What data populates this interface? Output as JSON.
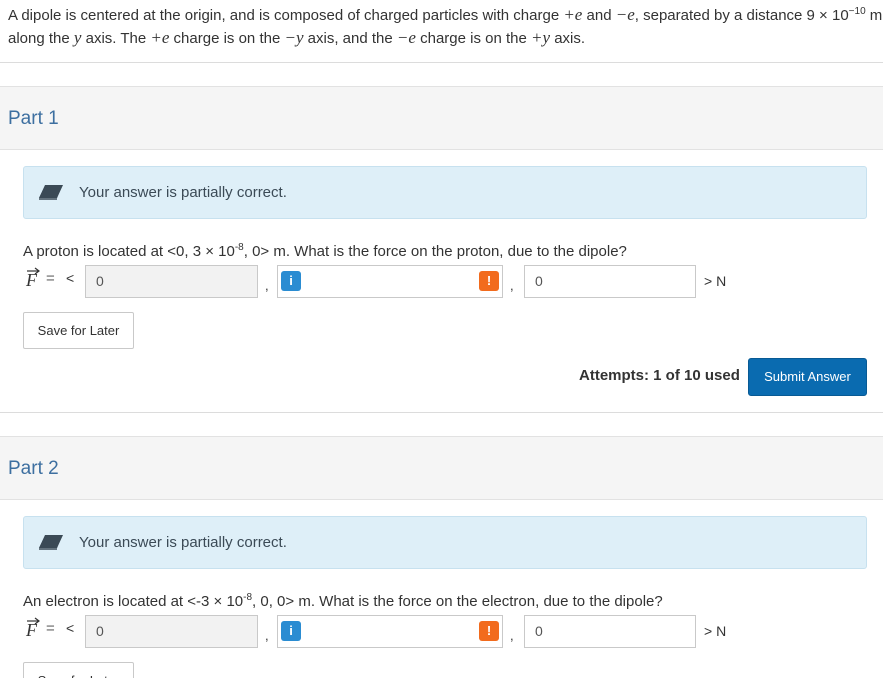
{
  "question": {
    "t1": "A dipole is centered at the origin, and is composed of charged particles with charge ",
    "plus_e": "+e",
    "t2": " and ",
    "minus_e": "−e",
    "t3": ", separated by a distance 9 × 10",
    "exp": "−10",
    "t4": " m along the ",
    "y1": "y",
    "t5": " axis. The ",
    "plus_e2": "+e",
    "t6": " charge is on the ",
    "neg_y": "−y",
    "t7": " axis, and the ",
    "minus_e2": "−e",
    "t8": " charge is on the ",
    "pos_y": "+y",
    "t9": " axis."
  },
  "parts": [
    {
      "title": "Part 1",
      "feedback": "Your answer is partially correct.",
      "prompt_a": "A proton is located at <0, 3 × 10",
      "prompt_exp": "-8",
      "prompt_b": ", 0> m. What is the force on the proton, due to the dipole?",
      "vector_symbol": "F",
      "equals": "=",
      "open": "<",
      "x_value": "0",
      "y_value": "",
      "z_value": "0",
      "comma": ",",
      "info_badge": "i",
      "warn_badge": "!",
      "unit": "> N",
      "save_label": "Save for Later",
      "attempts": "Attempts: 1 of 10 used",
      "submit_label": "Submit Answer"
    },
    {
      "title": "Part 2",
      "feedback": "Your answer is partially correct.",
      "prompt_a": "An electron is located at <-3 × 10",
      "prompt_exp": "-8",
      "prompt_b": ", 0, 0> m. What is the force on the electron, due to the dipole?",
      "vector_symbol": "F",
      "equals": "=",
      "open": "<",
      "x_value": "0",
      "y_value": "",
      "z_value": "0",
      "comma": ",",
      "info_badge": "i",
      "warn_badge": "!",
      "unit": "> N",
      "save_label": "Save for Later"
    }
  ],
  "colors": {
    "part_title": "#3d6fa0",
    "feedback_bg": "#deeff8",
    "info_badge": "#2a8cd2",
    "warn_badge": "#f26b1d",
    "submit_bg": "#0a6bb0"
  },
  "icons": {
    "feedback": "pencil-eraser-icon",
    "vector": "vector-arrow-icon"
  }
}
